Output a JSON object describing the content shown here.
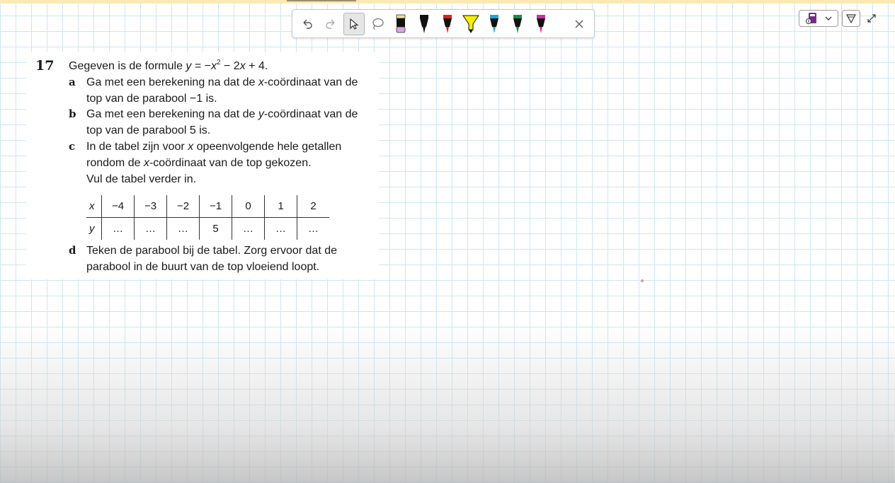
{
  "toolbar": {
    "tools": [
      "undo-icon",
      "redo-icon",
      "select-pointer-icon",
      "lasso-icon"
    ],
    "pens": [
      {
        "name": "highlighter-pink",
        "body": "#f5e3b0",
        "tip": "#d9a6e6"
      },
      {
        "name": "pen-black",
        "body": "#111111",
        "tip": "#111111"
      },
      {
        "name": "pen-red",
        "body": "#111111",
        "tip": "#e02020"
      },
      {
        "name": "highlighter-yellow",
        "body": "#111111",
        "tip": "#f5f000"
      },
      {
        "name": "pen-blue",
        "body": "#111111",
        "tip": "#1aa9d8"
      },
      {
        "name": "pen-green",
        "body": "#111111",
        "tip": "#1b8a4a"
      },
      {
        "name": "pen-magenta",
        "body": "#111111",
        "tip": "#d62ba3"
      }
    ]
  },
  "exercise": {
    "number": "17",
    "intro_text": "Gegeven is de formule ",
    "formula": {
      "y": "y",
      "eq": " = −",
      "x": "x",
      "exp": "2",
      "rest1": " − 2",
      "x2": "x",
      "rest2": " + 4."
    },
    "a": {
      "letter": "a",
      "l1a": "Ga met een berekening na dat de ",
      "l1var": "x",
      "l1b": "-coördinaat van de",
      "l2": "top van de parabool −1 is."
    },
    "b": {
      "letter": "b",
      "l1a": "Ga met een berekening na dat de ",
      "l1var": "y",
      "l1b": "-coördinaat van de",
      "l2": "top van de parabool 5 is."
    },
    "c": {
      "letter": "c",
      "l1a": "In de tabel zijn voor ",
      "l1var": "x",
      "l1b": " opeenvolgende hele getallen",
      "l2a": "rondom de ",
      "l2var": "x",
      "l2b": "-coördinaat van de top gekozen.",
      "l3": "Vul de tabel verder in."
    },
    "table": {
      "x_label": "x",
      "y_label": "y",
      "x": [
        "−4",
        "−3",
        "−2",
        "−1",
        "0",
        "1",
        "2"
      ],
      "y": [
        "…",
        "…",
        "…",
        "5",
        "…",
        "…",
        "…"
      ]
    },
    "d": {
      "letter": "d",
      "l1": "Teken de parabool bij de tabel. Zorg ervoor dat de",
      "l2": "parabool in de buurt van de top vloeiend loopt."
    }
  }
}
